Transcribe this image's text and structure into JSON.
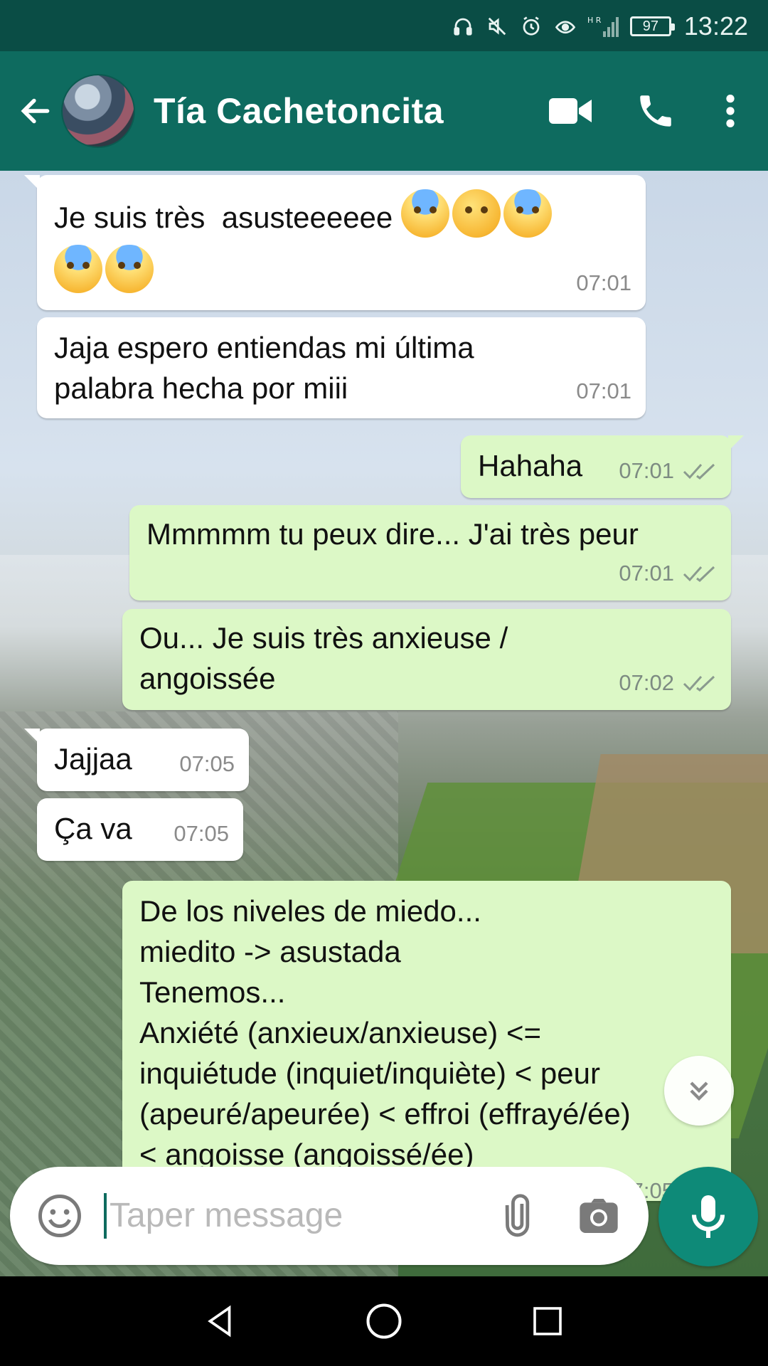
{
  "status_bar": {
    "battery": "97",
    "time": "13:22",
    "network": "H R"
  },
  "header": {
    "contact_name": "Tía Cachetoncita"
  },
  "messages": [
    {
      "direction": "in",
      "text": "Je suis très  asusteeeeee",
      "emojis": [
        "crying-face",
        "weary-face",
        "screaming-face",
        "fearful-face",
        "anxious-sweat-face"
      ],
      "time": "07:01"
    },
    {
      "direction": "in",
      "text": "Jaja espero entiendas mi última\npalabra hecha por miii",
      "time": "07:01"
    },
    {
      "direction": "out",
      "text": "Hahaha",
      "time": "07:01",
      "status": "read"
    },
    {
      "direction": "out",
      "text": "Mmmmm tu peux dire... J'ai très peur",
      "time": "07:01",
      "status": "read"
    },
    {
      "direction": "out",
      "text": "Ou... Je suis très anxieuse /\nangoissée",
      "time": "07:02",
      "status": "read"
    },
    {
      "direction": "in",
      "text": "Jajjaa",
      "time": "07:05"
    },
    {
      "direction": "in",
      "text": "Ça va",
      "time": "07:05"
    },
    {
      "direction": "out",
      "text": "De los niveles de miedo...\nmiedito -> asustada\nTenemos...\nAnxiété (anxieux/anxieuse) <=\ninquiétude (inquiet/inquiète) < peur\n(apeuré/apeurée) < effroi (effrayé/ée)\n< angoisse (angoissé/ée)",
      "time": "07:05",
      "status": "read"
    }
  ],
  "composer": {
    "placeholder": "Taper message"
  },
  "colors": {
    "header": "#0e6b5f",
    "status_bar": "#0a4d45",
    "outgoing_bubble": "#dcf8c6",
    "incoming_bubble": "#ffffff",
    "mic_button": "#0e8a78"
  }
}
